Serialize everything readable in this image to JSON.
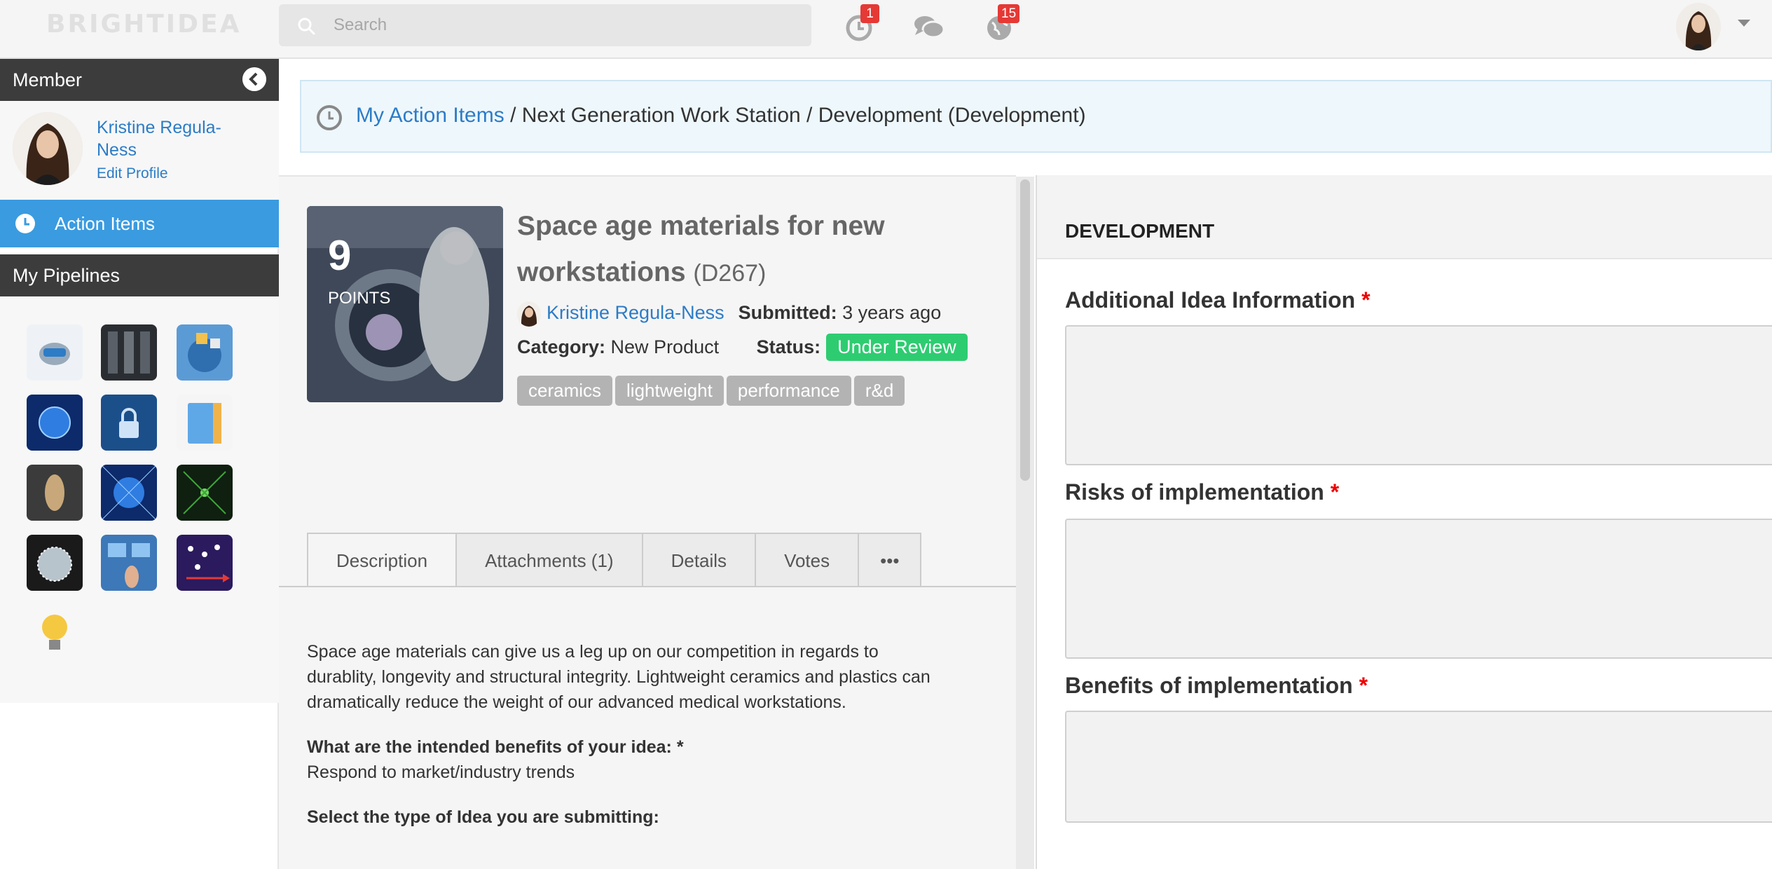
{
  "app": {
    "logo_text": "BRIGHTIDEA"
  },
  "topbar": {
    "search_placeholder": "Search",
    "action_badge": "1",
    "chat_badge": "",
    "notify_badge": "15"
  },
  "sidebar": {
    "member_header": "Member",
    "user_name": "Kristine Regula-Ness",
    "edit_profile": "Edit Profile",
    "action_items": "Action Items",
    "pipelines_header": "My Pipelines"
  },
  "breadcrumb": {
    "link": "My Action Items",
    "rest": " / Next Generation Work Station / Development (Development)"
  },
  "idea": {
    "points": "9",
    "points_label": "POINTS",
    "title": "Space age materials for new workstations",
    "code": "(D267)",
    "author": "Kristine Regula-Ness",
    "submitted_label": "Submitted:",
    "submitted_value": "3 years ago",
    "category_label": "Category:",
    "category_value": "New Product",
    "status_label": "Status:",
    "status_value": "Under Review",
    "tags": [
      "ceramics",
      "lightweight",
      "performance",
      "r&d"
    ],
    "tabs": [
      "Description",
      "Attachments (1)",
      "Details",
      "Votes",
      "•••"
    ],
    "description": "Space age materials can give us a leg up on our competition in regards to durablity, longevity and structural integrity.  Lightweight ceramics and plastics can dramatically reduce the weight of our advanced medical workstations.",
    "q1": "What are the intended benefits of your idea: *",
    "a1": "Respond to market/industry trends",
    "q2": "Select the type of Idea you are submitting:"
  },
  "development": {
    "header": "DEVELOPMENT",
    "fields": [
      {
        "label": "Additional Idea Information",
        "required": "*",
        "value": ""
      },
      {
        "label": "Risks of implementation",
        "required": "*",
        "value": ""
      },
      {
        "label": "Benefits of implementation",
        "required": "*",
        "value": ""
      }
    ]
  },
  "colors": {
    "accent_blue": "#3a9be0",
    "link_blue": "#2c7cc7",
    "status_green": "#2ecc71",
    "badge_red": "#e53935",
    "sidebar_header": "#3c3c3c"
  },
  "icons": {
    "search": "search-icon",
    "action": "clock-icon",
    "chat": "chat-bubbles-icon",
    "notify": "globe-icon",
    "collapse": "chevron-left-circle-icon"
  }
}
